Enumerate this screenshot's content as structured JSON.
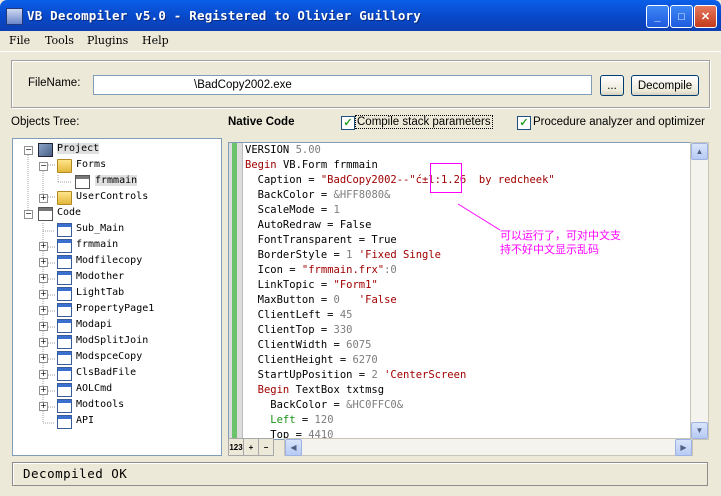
{
  "window": {
    "title": "VB Decompiler v5.0 - Registered to Olivier Guillory",
    "buttons": {
      "minimize": "_",
      "maximize": "□",
      "close": "✕"
    }
  },
  "menu": [
    "File",
    "Tools",
    "Plugins",
    "Help"
  ],
  "file": {
    "label": "FileName:",
    "value": "\\BadCopy2002.exe",
    "browse_label": "...",
    "decompile_label": "Decompile"
  },
  "tree": {
    "label": "Objects Tree:",
    "items": [
      {
        "label": "Project",
        "icon": "project-icon"
      },
      {
        "label": "Forms",
        "icon": "folder-open-icon"
      },
      {
        "label": "frmmain",
        "icon": "form-icon"
      },
      {
        "label": "UserControls",
        "icon": "folder-icon"
      },
      {
        "label": "Code",
        "icon": "code-icon"
      },
      {
        "label": "Sub_Main",
        "icon": "module-icon"
      },
      {
        "label": "frmmain",
        "icon": "module-icon"
      },
      {
        "label": "Modfilecopy",
        "icon": "module-icon"
      },
      {
        "label": "Modother",
        "icon": "module-icon"
      },
      {
        "label": "LightTab",
        "icon": "module-icon"
      },
      {
        "label": "PropertyPage1",
        "icon": "module-icon"
      },
      {
        "label": "Modapi",
        "icon": "module-icon"
      },
      {
        "label": "ModSplitJoin",
        "icon": "module-icon"
      },
      {
        "label": "ModspceCopy",
        "icon": "module-icon"
      },
      {
        "label": "ClsBadFile",
        "icon": "module-icon"
      },
      {
        "label": "AOLCmd",
        "icon": "module-icon"
      },
      {
        "label": "Modtools",
        "icon": "module-icon"
      },
      {
        "label": "API",
        "icon": "module-icon"
      }
    ]
  },
  "native": {
    "label": "Native Code",
    "opt1": "Compile stack parameters",
    "opt2": "Procedure analyzer and optimizer"
  },
  "code": {
    "l01a": "VERSION ",
    "l01b": "5.00",
    "l02a": "Begin ",
    "l02b": "VB.Form frmmain",
    "l03a": "  Caption = ",
    "l03b": "\"BadCopy2002--\"ć±l:1.26  by redcheek\"",
    "l04a": "  BackColor = ",
    "l04b": "&HFF8080&",
    "l05a": "  ScaleMode = ",
    "l05b": "1",
    "l06": "  AutoRedraw = False",
    "l07": "  FontTransparent = True",
    "l08a": "  BorderStyle = ",
    "l08b": "1",
    "l08c": " 'Fixed Single",
    "l09a": "  Icon = ",
    "l09b": "\"frmmain.frx\"",
    "l09c": ":0",
    "l10a": "  LinkTopic = ",
    "l10b": "\"Form1\"",
    "l11a": "  MaxButton = ",
    "l11b": "0",
    "l11c": "   'False",
    "l12a": "  ClientLeft = ",
    "l12b": "45",
    "l13a": "  ClientTop = ",
    "l13b": "330",
    "l14a": "  ClientWidth = ",
    "l14b": "6075",
    "l15a": "  ClientHeight = ",
    "l15b": "6270",
    "l16a": "  StartUpPosition = ",
    "l16b": "2",
    "l16c": " 'CenterScreen",
    "l17a": "  Begin ",
    "l17b": "TextBox txtmsg",
    "l18a": "    BackColor = ",
    "l18b": "&HC0FFC0&",
    "l19a": "    Left",
    "l19b": " = ",
    "l19c": "120",
    "l20a": "    Top = ",
    "l20b": "4410"
  },
  "annotation": "可以运行了，可对中文支持不好中文显示乱码",
  "status": "Decompiled OK",
  "colors": {
    "accent": "#0A5FE8",
    "annotation": "#FF00FF",
    "keyword": "#A00000",
    "number": "#7D7D7D"
  }
}
